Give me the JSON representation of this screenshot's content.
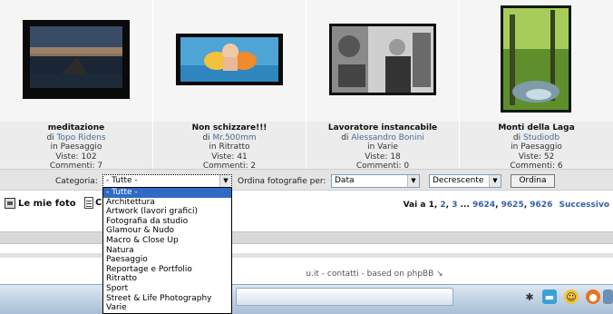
{
  "photos": [
    {
      "title": "meditazione",
      "by_prefix": "di",
      "author": "Topo Ridens",
      "category_line": "in Paesaggio",
      "views_line": "Viste: 102",
      "comments_line": "Commenti: 7"
    },
    {
      "title": "Non schizzare!!!",
      "by_prefix": "di",
      "author": "Mr.500mm",
      "category_line": "in Ritratto",
      "views_line": "Viste: 41",
      "comments_line": "Commenti: 2"
    },
    {
      "title": "Lavoratore instancabile",
      "by_prefix": "di",
      "author": "Alessandro Bonini",
      "category_line": "in Varie",
      "views_line": "Viste: 18",
      "comments_line": "Commenti: 0"
    },
    {
      "title": "Monti della Laga",
      "by_prefix": "di",
      "author": "Studiodb",
      "category_line": "in Paesaggio",
      "views_line": "Viste: 52",
      "comments_line": "Commenti: 6"
    }
  ],
  "filter": {
    "category_label": "Categoria:",
    "category_value": "- Tutte -",
    "order_label": "Ordina fotografie per:",
    "order_value": "Data",
    "direction_value": "Decrescente",
    "order_button": "Ordina"
  },
  "category_options": [
    "- Tutte -",
    "Architettura",
    "Artwork (lavori grafici)",
    "Fotografia da studio",
    "Glamour & Nudo",
    "Macro & Close Up",
    "Natura",
    "Paesaggio",
    "Reportage e Portfolio",
    "Ritratto",
    "Sport",
    "Street & Life Photography",
    "Varie"
  ],
  "links": {
    "my_photos": "Le mie foto",
    "second_link_partial": "C"
  },
  "pagination": {
    "prefix": "Vai a",
    "current": "1",
    "p2": "2",
    "p3": "3",
    "ellipsis": "...",
    "p9624": "9624",
    "p9625": "9625",
    "p9626": "9626",
    "next": "Successivo"
  },
  "footer": {
    "partial_domain": "u.it",
    "contatti": "contatti",
    "based_on": "based on",
    "phpbb": "phpBB",
    "arrow": "↘"
  },
  "colors": {
    "link": "#4a6b93",
    "selected_option": "#316ac5",
    "taskbar": "#c7d6e6"
  },
  "tray_icons": [
    "bug-icon",
    "chat-icon",
    "smiley-icon",
    "firefox-icon",
    "network-icon"
  ]
}
